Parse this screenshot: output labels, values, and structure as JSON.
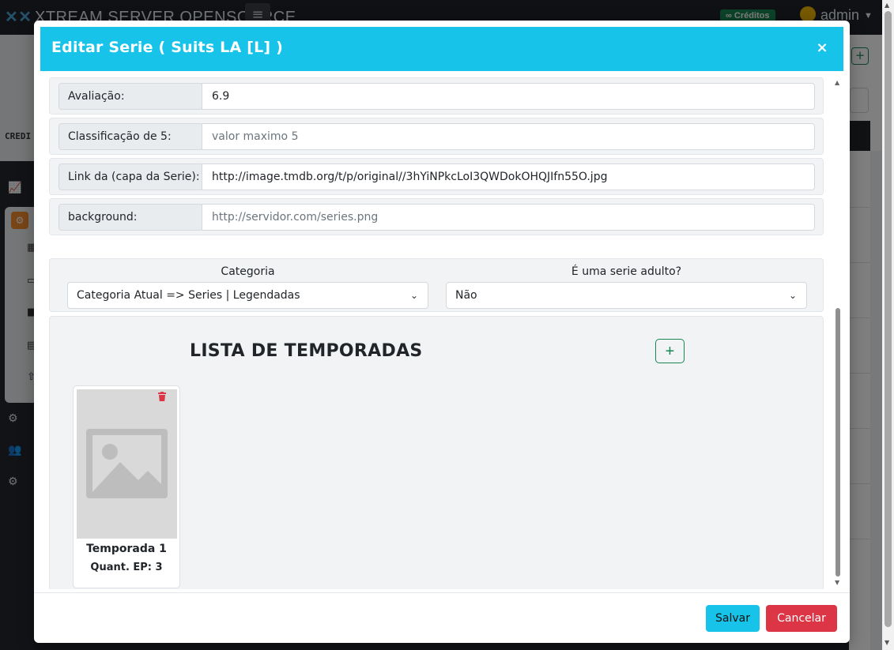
{
  "app": {
    "brand": "XTREAM SERVER OPENSOURCE",
    "credits_label": "∞ Créditos",
    "user_name": "admin",
    "sidebar_caption": "CREDI"
  },
  "modal": {
    "title": "Editar Serie ( Suits LA [L] )",
    "close_symbol": "×",
    "fields": [
      {
        "label": "Avaliação:",
        "value": "6.9",
        "placeholder": ""
      },
      {
        "label": "Classificação de 5:",
        "value": "",
        "placeholder": "valor maximo 5"
      },
      {
        "label": "Link da (capa da Serie):",
        "value": "http://image.tmdb.org/t/p/original//3hYiNPkcLoI3QWDokOHQJIfn55O.jpg",
        "placeholder": ""
      },
      {
        "label": "background:",
        "value": "",
        "placeholder": "http://servidor.com/series.png"
      }
    ],
    "category": {
      "caption": "Categoria",
      "selected": "Categoria Atual => Series | Legendadas"
    },
    "adult": {
      "caption": "É uma serie adulto?",
      "selected": "Não"
    },
    "seasons": {
      "title": "LISTA DE TEMPORADAS",
      "add_symbol": "+",
      "items": [
        {
          "name": "Temporada 1",
          "episodes": "Quant. EP: 3"
        }
      ]
    },
    "footer": {
      "save_label": "Salvar",
      "cancel_label": "Cancelar"
    }
  },
  "colors": {
    "header": "#17c3e8",
    "save": "#17c3e8",
    "cancel": "#dc3545",
    "add": "#198754"
  }
}
